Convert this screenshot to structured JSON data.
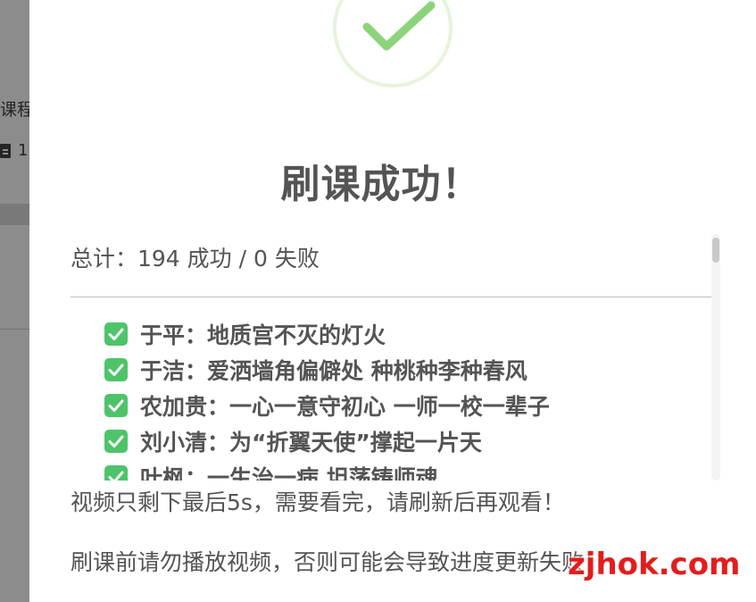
{
  "background": {
    "partial_label": "课程",
    "partial_count": "1"
  },
  "modal": {
    "title": "刷课成功！",
    "summary": "总计：194 成功 / 0 失败",
    "courses": [
      {
        "label": "于平：地质宫不灭的灯火"
      },
      {
        "label": "于洁：爱洒墙角偏僻处 种桃种李种春风"
      },
      {
        "label": "农加贵：一心一意守初心 一师一校一辈子"
      },
      {
        "label": "刘小清：为“折翼天使”撑起一片天"
      },
      {
        "label": "叶枫：一生治一病 坦荡铸师魂"
      }
    ],
    "note_1": "视频只剩下最后5s，需要看完，请刷新后再观看！",
    "note_2": "刷课前请勿播放视频，否则可能会导致进度更新失败！"
  },
  "watermark": "zjhok.com",
  "icons": {
    "success": "check-circle-icon",
    "course_status": "check-mark-icon"
  },
  "colors": {
    "success_green": "#8cd47a",
    "check_box_green": "#4ec46a",
    "text": "#545454",
    "watermark": "#e31d1d"
  }
}
